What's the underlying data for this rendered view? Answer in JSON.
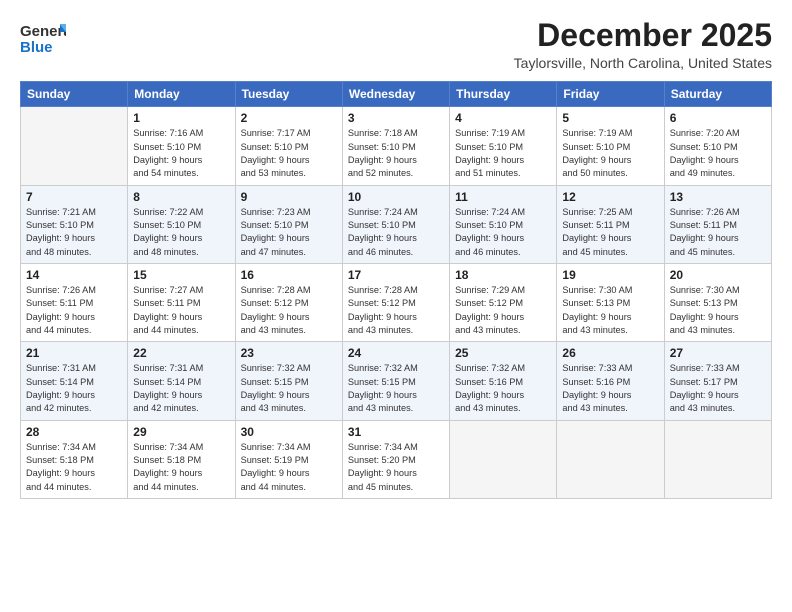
{
  "logo": {
    "line1": "General",
    "line2": "Blue",
    "icon_color": "#1a73c9"
  },
  "title": {
    "month": "December 2025",
    "location": "Taylorsville, North Carolina, United States"
  },
  "weekdays": [
    "Sunday",
    "Monday",
    "Tuesday",
    "Wednesday",
    "Thursday",
    "Friday",
    "Saturday"
  ],
  "weeks": [
    [
      {
        "day": "",
        "empty": true
      },
      {
        "day": "1",
        "sunrise": "Sunrise: 7:16 AM",
        "sunset": "Sunset: 5:10 PM",
        "daylight": "Daylight: 9 hours and 54 minutes."
      },
      {
        "day": "2",
        "sunrise": "Sunrise: 7:17 AM",
        "sunset": "Sunset: 5:10 PM",
        "daylight": "Daylight: 9 hours and 53 minutes."
      },
      {
        "day": "3",
        "sunrise": "Sunrise: 7:18 AM",
        "sunset": "Sunset: 5:10 PM",
        "daylight": "Daylight: 9 hours and 52 minutes."
      },
      {
        "day": "4",
        "sunrise": "Sunrise: 7:19 AM",
        "sunset": "Sunset: 5:10 PM",
        "daylight": "Daylight: 9 hours and 51 minutes."
      },
      {
        "day": "5",
        "sunrise": "Sunrise: 7:19 AM",
        "sunset": "Sunset: 5:10 PM",
        "daylight": "Daylight: 9 hours and 50 minutes."
      },
      {
        "day": "6",
        "sunrise": "Sunrise: 7:20 AM",
        "sunset": "Sunset: 5:10 PM",
        "daylight": "Daylight: 9 hours and 49 minutes."
      }
    ],
    [
      {
        "day": "7",
        "sunrise": "Sunrise: 7:21 AM",
        "sunset": "Sunset: 5:10 PM",
        "daylight": "Daylight: 9 hours and 48 minutes."
      },
      {
        "day": "8",
        "sunrise": "Sunrise: 7:22 AM",
        "sunset": "Sunset: 5:10 PM",
        "daylight": "Daylight: 9 hours and 48 minutes."
      },
      {
        "day": "9",
        "sunrise": "Sunrise: 7:23 AM",
        "sunset": "Sunset: 5:10 PM",
        "daylight": "Daylight: 9 hours and 47 minutes."
      },
      {
        "day": "10",
        "sunrise": "Sunrise: 7:24 AM",
        "sunset": "Sunset: 5:10 PM",
        "daylight": "Daylight: 9 hours and 46 minutes."
      },
      {
        "day": "11",
        "sunrise": "Sunrise: 7:24 AM",
        "sunset": "Sunset: 5:10 PM",
        "daylight": "Daylight: 9 hours and 46 minutes."
      },
      {
        "day": "12",
        "sunrise": "Sunrise: 7:25 AM",
        "sunset": "Sunset: 5:11 PM",
        "daylight": "Daylight: 9 hours and 45 minutes."
      },
      {
        "day": "13",
        "sunrise": "Sunrise: 7:26 AM",
        "sunset": "Sunset: 5:11 PM",
        "daylight": "Daylight: 9 hours and 45 minutes."
      }
    ],
    [
      {
        "day": "14",
        "sunrise": "Sunrise: 7:26 AM",
        "sunset": "Sunset: 5:11 PM",
        "daylight": "Daylight: 9 hours and 44 minutes."
      },
      {
        "day": "15",
        "sunrise": "Sunrise: 7:27 AM",
        "sunset": "Sunset: 5:11 PM",
        "daylight": "Daylight: 9 hours and 44 minutes."
      },
      {
        "day": "16",
        "sunrise": "Sunrise: 7:28 AM",
        "sunset": "Sunset: 5:12 PM",
        "daylight": "Daylight: 9 hours and 43 minutes."
      },
      {
        "day": "17",
        "sunrise": "Sunrise: 7:28 AM",
        "sunset": "Sunset: 5:12 PM",
        "daylight": "Daylight: 9 hours and 43 minutes."
      },
      {
        "day": "18",
        "sunrise": "Sunrise: 7:29 AM",
        "sunset": "Sunset: 5:12 PM",
        "daylight": "Daylight: 9 hours and 43 minutes."
      },
      {
        "day": "19",
        "sunrise": "Sunrise: 7:30 AM",
        "sunset": "Sunset: 5:13 PM",
        "daylight": "Daylight: 9 hours and 43 minutes."
      },
      {
        "day": "20",
        "sunrise": "Sunrise: 7:30 AM",
        "sunset": "Sunset: 5:13 PM",
        "daylight": "Daylight: 9 hours and 43 minutes."
      }
    ],
    [
      {
        "day": "21",
        "sunrise": "Sunrise: 7:31 AM",
        "sunset": "Sunset: 5:14 PM",
        "daylight": "Daylight: 9 hours and 42 minutes."
      },
      {
        "day": "22",
        "sunrise": "Sunrise: 7:31 AM",
        "sunset": "Sunset: 5:14 PM",
        "daylight": "Daylight: 9 hours and 42 minutes."
      },
      {
        "day": "23",
        "sunrise": "Sunrise: 7:32 AM",
        "sunset": "Sunset: 5:15 PM",
        "daylight": "Daylight: 9 hours and 43 minutes."
      },
      {
        "day": "24",
        "sunrise": "Sunrise: 7:32 AM",
        "sunset": "Sunset: 5:15 PM",
        "daylight": "Daylight: 9 hours and 43 minutes."
      },
      {
        "day": "25",
        "sunrise": "Sunrise: 7:32 AM",
        "sunset": "Sunset: 5:16 PM",
        "daylight": "Daylight: 9 hours and 43 minutes."
      },
      {
        "day": "26",
        "sunrise": "Sunrise: 7:33 AM",
        "sunset": "Sunset: 5:16 PM",
        "daylight": "Daylight: 9 hours and 43 minutes."
      },
      {
        "day": "27",
        "sunrise": "Sunrise: 7:33 AM",
        "sunset": "Sunset: 5:17 PM",
        "daylight": "Daylight: 9 hours and 43 minutes."
      }
    ],
    [
      {
        "day": "28",
        "sunrise": "Sunrise: 7:34 AM",
        "sunset": "Sunset: 5:18 PM",
        "daylight": "Daylight: 9 hours and 44 minutes."
      },
      {
        "day": "29",
        "sunrise": "Sunrise: 7:34 AM",
        "sunset": "Sunset: 5:18 PM",
        "daylight": "Daylight: 9 hours and 44 minutes."
      },
      {
        "day": "30",
        "sunrise": "Sunrise: 7:34 AM",
        "sunset": "Sunset: 5:19 PM",
        "daylight": "Daylight: 9 hours and 44 minutes."
      },
      {
        "day": "31",
        "sunrise": "Sunrise: 7:34 AM",
        "sunset": "Sunset: 5:20 PM",
        "daylight": "Daylight: 9 hours and 45 minutes."
      },
      {
        "day": "",
        "empty": true
      },
      {
        "day": "",
        "empty": true
      },
      {
        "day": "",
        "empty": true
      }
    ]
  ]
}
